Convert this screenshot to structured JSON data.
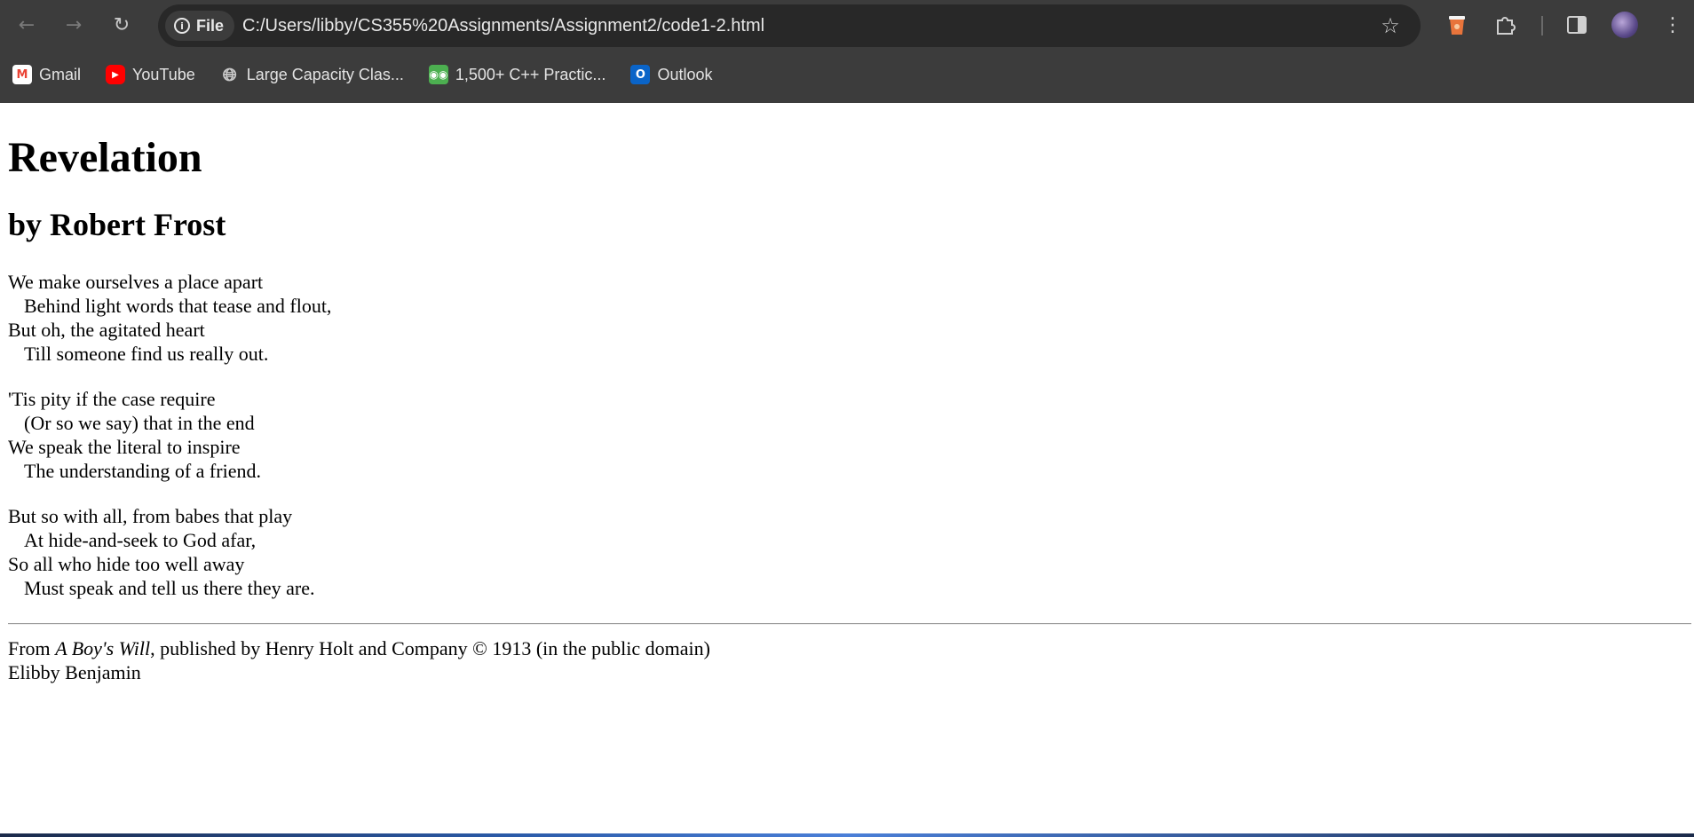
{
  "browser": {
    "nav": {
      "back_icon": "arrow-left-icon",
      "forward_icon": "arrow-right-icon",
      "reload_icon": "reload-icon"
    },
    "omnibox": {
      "chip_label": "File",
      "url": "C:/Users/libby/CS355%20Assignments/Assignment2/code1-2.html"
    },
    "bookmarks": [
      {
        "label": "Gmail",
        "icon": "gmail-icon"
      },
      {
        "label": "YouTube",
        "icon": "youtube-icon"
      },
      {
        "label": "Large Capacity Clas...",
        "icon": "globe-icon"
      },
      {
        "label": "1,500+ C++ Practic...",
        "icon": "cpp-icon"
      },
      {
        "label": "Outlook",
        "icon": "outlook-icon"
      }
    ],
    "colors": {
      "chrome": "#3c3c3c",
      "omnibox": "#282828",
      "text": "#e8e8e8"
    }
  },
  "poem": {
    "title": "Revelation",
    "author": "by Robert Frost",
    "stanzas": [
      [
        "We make ourselves a place apart",
        "Behind light words that tease and flout,",
        "But oh, the agitated heart",
        "Till someone find us really out."
      ],
      [
        "'Tis pity if the case require",
        "(Or so we say) that in the end",
        "We speak the literal to inspire",
        "The understanding of a friend."
      ],
      [
        "But so with all, from babes that play",
        "At hide-and-seek to God afar,",
        "So all who hide too well away",
        "Must speak and tell us there they are."
      ]
    ]
  },
  "footer": {
    "from_prefix": "From ",
    "book_title": "A Boy's Will",
    "publisher_text": ", published by Henry Holt and Company © 1913 (in the public domain)",
    "student_name": "Elibby Benjamin"
  }
}
